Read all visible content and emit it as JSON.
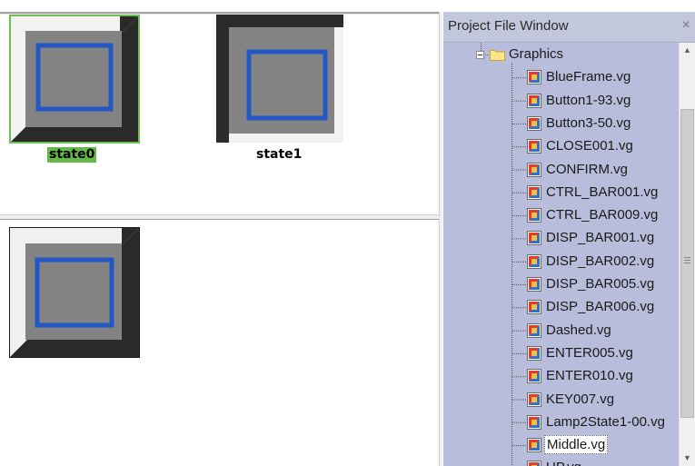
{
  "editor": {
    "states": [
      {
        "label": "state0"
      },
      {
        "label": "state1"
      }
    ]
  },
  "project_window": {
    "title": "Project File Window",
    "close_glyph": "×",
    "folder": {
      "label": "Graphics",
      "icon": "folder-icon",
      "expander": "collapse"
    },
    "files": [
      {
        "label": "BlueFrame.vg"
      },
      {
        "label": "Button1-93.vg"
      },
      {
        "label": "Button3-50.vg"
      },
      {
        "label": "CLOSE001.vg"
      },
      {
        "label": "CONFIRM.vg"
      },
      {
        "label": "CTRL_BAR001.vg"
      },
      {
        "label": "CTRL_BAR009.vg"
      },
      {
        "label": "DISP_BAR001.vg"
      },
      {
        "label": "DISP_BAR002.vg"
      },
      {
        "label": "DISP_BAR005.vg"
      },
      {
        "label": "DISP_BAR006.vg"
      },
      {
        "label": "Dashed.vg"
      },
      {
        "label": "ENTER005.vg"
      },
      {
        "label": "ENTER010.vg"
      },
      {
        "label": "KEY007.vg"
      },
      {
        "label": "Lamp2State1-00.vg"
      },
      {
        "label": "Middle.vg",
        "selected": true
      },
      {
        "label": "UP.vg"
      }
    ],
    "scroll_up": "▲",
    "scroll_down": "▼"
  },
  "colors": {
    "tree_bg": "#b9bddc",
    "title_bg": "#c2c7dc",
    "selection_highlight": "#67b84a",
    "frame_blue": "#2257c4",
    "button_gray": "#838383"
  }
}
